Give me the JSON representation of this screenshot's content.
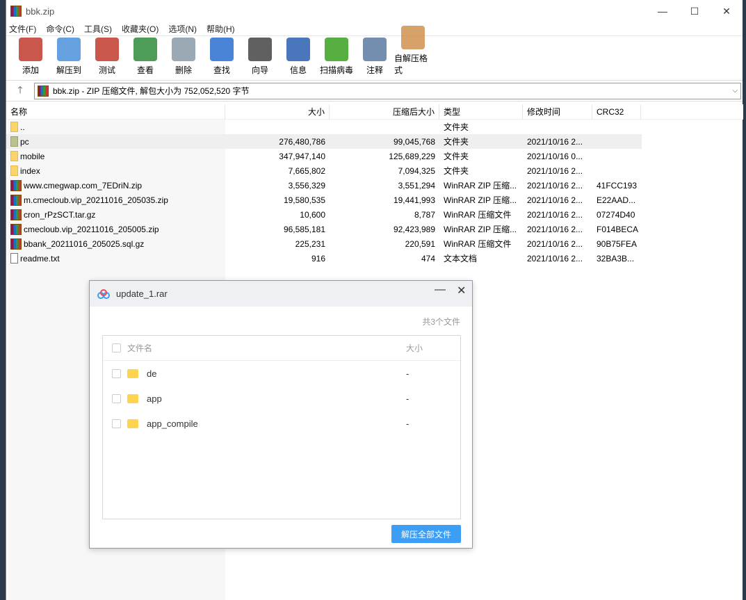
{
  "window": {
    "title": "bbk.zip"
  },
  "menu": [
    "文件(F)",
    "命令(C)",
    "工具(S)",
    "收藏夹(O)",
    "选项(N)",
    "帮助(H)"
  ],
  "toolbar": [
    {
      "label": "添加",
      "icon": "add-icon",
      "color": "#c0392b"
    },
    {
      "label": "解压到",
      "icon": "extract-folder-icon",
      "color": "#4a90d9"
    },
    {
      "label": "测试",
      "icon": "test-clipboard-icon",
      "color": "#c0392b"
    },
    {
      "label": "查看",
      "icon": "view-book-icon",
      "color": "#2e8b3a"
    },
    {
      "label": "删除",
      "icon": "trash-icon",
      "color": "#8a9aa8"
    },
    {
      "label": "查找",
      "icon": "find-magnifier-icon",
      "color": "#2a6fd0"
    },
    {
      "label": "向导",
      "icon": "wizard-wand-icon",
      "color": "#444444"
    },
    {
      "label": "信息",
      "icon": "info-icon",
      "color": "#2a5fb0"
    },
    {
      "label": "扫描病毒",
      "icon": "virus-scan-icon",
      "color": "#3aa020"
    },
    {
      "label": "注释",
      "icon": "comment-icon",
      "color": "#5a7aa0"
    },
    {
      "label": "自解压格式",
      "icon": "sfx-box-icon",
      "color": "#d09050"
    }
  ],
  "address": "bbk.zip - ZIP 压缩文件, 解包大小为 752,052,520 字节",
  "columns": [
    "名称",
    "大小",
    "压缩后大小",
    "类型",
    "修改时间",
    "CRC32"
  ],
  "files": [
    {
      "name": "..",
      "size": "",
      "packed": "",
      "type": "文件夹",
      "mtime": "",
      "crc": "",
      "icon": "folder"
    },
    {
      "name": "pc",
      "size": "276,480,786",
      "packed": "99,045,768",
      "type": "文件夹",
      "mtime": "2021/10/16 2...",
      "crc": "",
      "icon": "folder-green",
      "selected": true
    },
    {
      "name": "mobile",
      "size": "347,947,140",
      "packed": "125,689,229",
      "type": "文件夹",
      "mtime": "2021/10/16 0...",
      "crc": "",
      "icon": "folder"
    },
    {
      "name": "index",
      "size": "7,665,802",
      "packed": "7,094,325",
      "type": "文件夹",
      "mtime": "2021/10/16 2...",
      "crc": "",
      "icon": "folder"
    },
    {
      "name": "www.cmegwap.com_7EDriN.zip",
      "size": "3,556,329",
      "packed": "3,551,294",
      "type": "WinRAR ZIP 压缩...",
      "mtime": "2021/10/16 2...",
      "crc": "41FCC193",
      "icon": "rar"
    },
    {
      "name": "m.cmecloub.vip_20211016_205035.zip",
      "size": "19,580,535",
      "packed": "19,441,993",
      "type": "WinRAR ZIP 压缩...",
      "mtime": "2021/10/16 2...",
      "crc": "E22AAD...",
      "icon": "rar"
    },
    {
      "name": "cron_rPzSCT.tar.gz",
      "size": "10,600",
      "packed": "8,787",
      "type": "WinRAR 压缩文件",
      "mtime": "2021/10/16 2...",
      "crc": "07274D40",
      "icon": "rar"
    },
    {
      "name": "cmecloub.vip_20211016_205005.zip",
      "size": "96,585,181",
      "packed": "92,423,989",
      "type": "WinRAR ZIP 压缩...",
      "mtime": "2021/10/16 2...",
      "crc": "F014BECA",
      "icon": "rar"
    },
    {
      "name": "bbank_20211016_205025.sql.gz",
      "size": "225,231",
      "packed": "220,591",
      "type": "WinRAR 压缩文件",
      "mtime": "2021/10/16 2...",
      "crc": "90B75FEA",
      "icon": "rar"
    },
    {
      "name": "readme.txt",
      "size": "916",
      "packed": "474",
      "type": "文本文档",
      "mtime": "2021/10/16 2...",
      "crc": "32BA3B...",
      "icon": "txt"
    }
  ],
  "dialog": {
    "title": "update_1.rar",
    "count": "共3个文件",
    "col_name": "文件名",
    "col_size": "大小",
    "items": [
      {
        "name": "de",
        "size": "-"
      },
      {
        "name": "app",
        "size": "-"
      },
      {
        "name": "app_compile",
        "size": "-"
      }
    ],
    "extract_all": "解压全部文件",
    "accent": "#3d9ef5"
  }
}
